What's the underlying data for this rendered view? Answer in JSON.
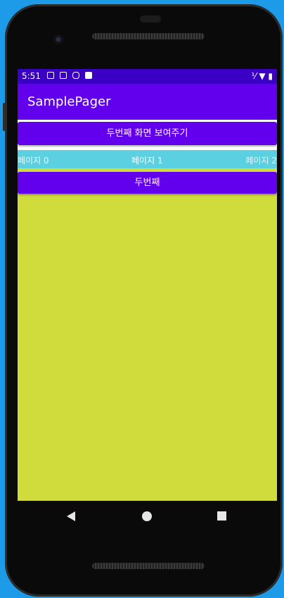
{
  "status_bar": {
    "time": "5:51"
  },
  "app_bar": {
    "title": "SamplePager"
  },
  "main": {
    "show_second_button": "두번째 화면 보여주기",
    "tabs": [
      {
        "label": "페이지 0"
      },
      {
        "label": "페이지 1"
      },
      {
        "label": "페이지 2"
      }
    ],
    "page_button": "두번째"
  },
  "colors": {
    "status_bar": "#3a00c4",
    "app_bar": "#6200ee",
    "button": "#6200ee",
    "tab_strip": "#5bd0e0",
    "page_background": "#cfdc3b",
    "device_background": "#1e9be8"
  },
  "icons": {
    "status": [
      "notification-icon",
      "a-icon",
      "debug-icon",
      "sd-card-icon",
      "no-signal-icon",
      "wifi-icon",
      "battery-icon"
    ],
    "nav": [
      "back-icon",
      "home-icon",
      "recents-icon"
    ]
  }
}
